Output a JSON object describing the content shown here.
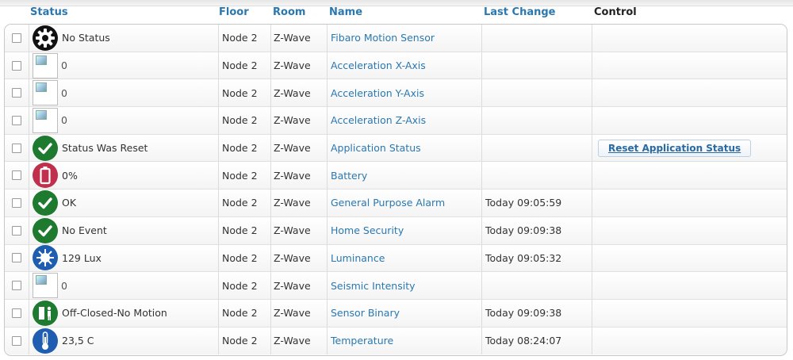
{
  "header": {
    "status": "Status",
    "floor": "Floor",
    "room": "Room",
    "name": "Name",
    "last_change": "Last Change",
    "control": "Control"
  },
  "colors": {
    "link": "#2a78b0",
    "ok_green": "#1e7a2e",
    "battery_red": "#c0304c",
    "sensor_blue": "#1e5db0"
  },
  "rows": [
    {
      "icon": "gear-icon",
      "status": "No Status",
      "floor": "Node 2",
      "room": "Z-Wave",
      "name": "Fibaro Motion Sensor",
      "last_change": "",
      "control": ""
    },
    {
      "icon": "broken-image-icon",
      "status": "0",
      "floor": "Node 2",
      "room": "Z-Wave",
      "name": "Acceleration X-Axis",
      "last_change": "",
      "control": ""
    },
    {
      "icon": "broken-image-icon",
      "status": "0",
      "floor": "Node 2",
      "room": "Z-Wave",
      "name": "Acceleration Y-Axis",
      "last_change": "",
      "control": ""
    },
    {
      "icon": "broken-image-icon",
      "status": "0",
      "floor": "Node 2",
      "room": "Z-Wave",
      "name": "Acceleration Z-Axis",
      "last_change": "",
      "control": ""
    },
    {
      "icon": "checkmark-icon",
      "status": "Status Was Reset",
      "floor": "Node 2",
      "room": "Z-Wave",
      "name": "Application Status",
      "last_change": "",
      "control": "Reset Application Status"
    },
    {
      "icon": "battery-icon",
      "status": "0%",
      "floor": "Node 2",
      "room": "Z-Wave",
      "name": "Battery",
      "last_change": "",
      "control": ""
    },
    {
      "icon": "checkmark-icon",
      "status": "OK",
      "floor": "Node 2",
      "room": "Z-Wave",
      "name": "General Purpose Alarm",
      "last_change": "Today 09:05:59",
      "control": ""
    },
    {
      "icon": "checkmark-icon",
      "status": "No Event",
      "floor": "Node 2",
      "room": "Z-Wave",
      "name": "Home Security",
      "last_change": "Today 09:09:38",
      "control": ""
    },
    {
      "icon": "sun-icon",
      "status": "129 Lux",
      "floor": "Node 2",
      "room": "Z-Wave",
      "name": "Luminance",
      "last_change": "Today 09:05:32",
      "control": ""
    },
    {
      "icon": "broken-image-icon",
      "status": "0",
      "floor": "Node 2",
      "room": "Z-Wave",
      "name": "Seismic Intensity",
      "last_change": "",
      "control": ""
    },
    {
      "icon": "door-motion-icon",
      "status": "Off-Closed-No Motion",
      "floor": "Node 2",
      "room": "Z-Wave",
      "name": "Sensor Binary",
      "last_change": "Today 09:09:38",
      "control": ""
    },
    {
      "icon": "thermometer-icon",
      "status": "23,5 C",
      "floor": "Node 2",
      "room": "Z-Wave",
      "name": "Temperature",
      "last_change": "Today 08:24:07",
      "control": ""
    }
  ]
}
